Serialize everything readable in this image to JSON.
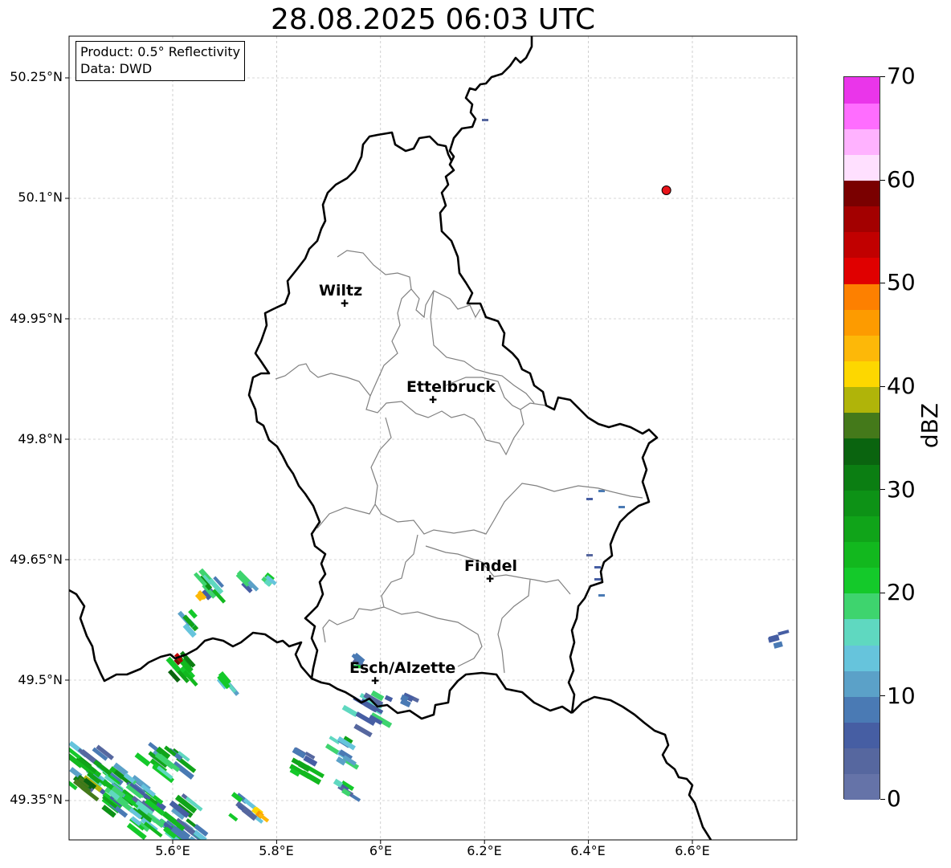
{
  "title": "28.08.2025 06:03 UTC",
  "info": {
    "product": "Product: 0.5° Reflectivity",
    "data": "Data: DWD"
  },
  "map": {
    "lon_range": [
      5.4,
      6.8
    ],
    "lat_range": [
      49.3,
      50.3
    ],
    "lon_ticks": [
      "5.6°E",
      "5.8°E",
      "6°E",
      "6.2°E",
      "6.4°E",
      "6.6°E"
    ],
    "lat_ticks": [
      "50.25°N",
      "50.1°N",
      "49.95°N",
      "49.8°N",
      "49.65°N",
      "49.5°N",
      "49.35°N"
    ],
    "cities": [
      {
        "name": "Wiltz",
        "lon": 5.93,
        "lat": 49.97
      },
      {
        "name": "Ettelbruck",
        "lon": 6.1,
        "lat": 49.85
      },
      {
        "name": "Findel",
        "lon": 6.21,
        "lat": 49.63
      },
      {
        "name": "Esch/Alzette",
        "lon": 5.99,
        "lat": 49.5
      }
    ],
    "marker": {
      "lon": 6.55,
      "lat": 50.11,
      "color": "#e8141a"
    }
  },
  "colorbar": {
    "label": "dBZ",
    "min": 0,
    "max": 70,
    "ticks": [
      "0",
      "10",
      "20",
      "30",
      "40",
      "50",
      "60",
      "70"
    ],
    "colors": [
      "#6573a8",
      "#56679f",
      "#465ea3",
      "#4a7ab4",
      "#5ba1c8",
      "#66c4dc",
      "#5fd8c0",
      "#3ed46e",
      "#14c92a",
      "#12b81e",
      "#10a419",
      "#0d9216",
      "#0b7e12",
      "#0a640f",
      "#44791a",
      "#b0b409",
      "#fdd700",
      "#fdb808",
      "#fd9b00",
      "#fd8000",
      "#e00000",
      "#c10000",
      "#a30000",
      "#7a0000",
      "#ffe0ff",
      "#ffb2ff",
      "#ff6dff",
      "#ea35ea"
    ]
  }
}
